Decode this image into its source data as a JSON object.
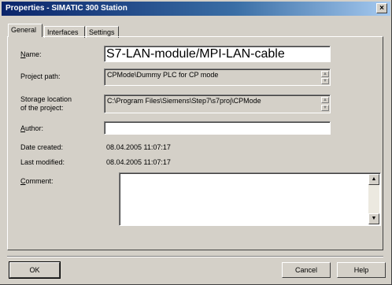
{
  "window": {
    "title": "Properties - SIMATIC 300 Station",
    "close_glyph": "×"
  },
  "tabs": [
    {
      "label": "General",
      "active": true
    },
    {
      "label": "Interfaces",
      "active": false
    },
    {
      "label": "Settings",
      "active": false
    }
  ],
  "fields": {
    "name": {
      "label_u": "N",
      "label_rest": "ame:",
      "value": "S7-LAN-module/MPI-LAN-cable"
    },
    "project_path": {
      "label": "Project path:",
      "value": "CPMode\\Dummy PLC for CP mode"
    },
    "storage_location": {
      "label_line1": "Storage location",
      "label_line2": "of the project:",
      "value": "C:\\Program Files\\Siemens\\Step7\\s7proj\\CPMode"
    },
    "author": {
      "label_u": "A",
      "label_rest": "uthor:",
      "value": ""
    },
    "date_created": {
      "label": "Date created:",
      "value": "08.04.2005   11:07:17"
    },
    "last_modified": {
      "label": "Last modified:",
      "value": "08.04.2005   11:07:17"
    },
    "comment": {
      "label_u": "C",
      "label_rest": "omment:",
      "value": ""
    }
  },
  "buttons": {
    "ok": "OK",
    "cancel": "Cancel",
    "help": "Help"
  },
  "icons": {
    "up_arrow": "▲",
    "down_arrow": "▼"
  }
}
